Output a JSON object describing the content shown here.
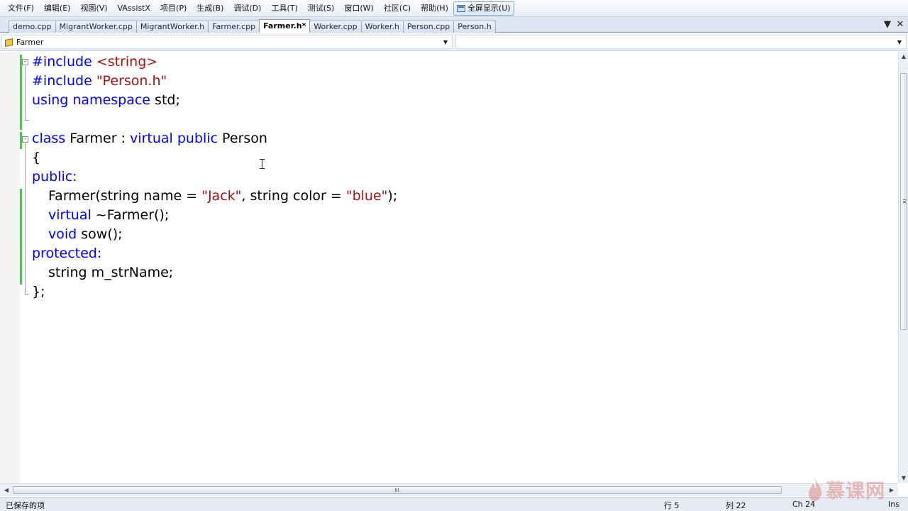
{
  "menu": [
    "文件(F)",
    "编辑(E)",
    "视图(V)",
    "VAssistX",
    "项目(P)",
    "生成(B)",
    "调试(D)",
    "工具(T)",
    "测试(S)",
    "窗口(W)",
    "社区(C)",
    "帮助(H)"
  ],
  "fullscreen_label": "全屏显示(U)",
  "tabs": [
    {
      "label": "demo.cpp",
      "active": false
    },
    {
      "label": "MigrantWorker.cpp",
      "active": false
    },
    {
      "label": "MigrantWorker.h",
      "active": false
    },
    {
      "label": "Farmer.cpp",
      "active": false
    },
    {
      "label": "Farmer.h*",
      "active": true
    },
    {
      "label": "Worker.cpp",
      "active": false
    },
    {
      "label": "Worker.h",
      "active": false
    },
    {
      "label": "Person.cpp",
      "active": false
    },
    {
      "label": "Person.h",
      "active": false
    }
  ],
  "tab_controls": {
    "dropdown": "▼",
    "close": "✕"
  },
  "nav": {
    "class_selector": "Farmer",
    "member_selector": ""
  },
  "code": {
    "line1_kw": "#include",
    "line1_str": "<string>",
    "line2_kw": "#include",
    "line2_str": "\"Person.h\"",
    "line3_kw1": "using",
    "line3_kw2": "namespace",
    "line3_rest": "std;",
    "line5_kw1": "class",
    "line5_name": "Farmer :",
    "line5_kw2": "virtual",
    "line5_kw3": "public",
    "line5_base": "Person",
    "line6": "{",
    "line7_kw": "public:",
    "line8_a": "Farmer(string name = ",
    "line8_str1": "\"Jack\"",
    "line8_b": ", string color = ",
    "line8_str2": "\"blue\"",
    "line8_c": ");",
    "line9_kw": "virtual",
    "line9_rest": "~Farmer();",
    "line10_kw": "void",
    "line10_rest": "sow();",
    "line11_kw": "protected:",
    "line12": "string m_strName;",
    "line13": "};"
  },
  "status": {
    "message": "已保存的项",
    "line": "行 5",
    "col": "列 22",
    "ch": "Ch 24",
    "mode": "Ins"
  },
  "watermark": "慕课网"
}
